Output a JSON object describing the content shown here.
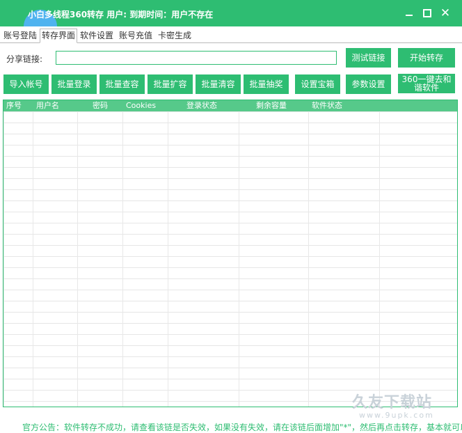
{
  "window": {
    "title": "小白多线程360转存 用户: 到期时间：用户不存在",
    "controls": {
      "minimize": "minimize-icon",
      "maximize": "maximize-icon",
      "close": "✕"
    }
  },
  "tabs": [
    {
      "label": "账号登陆",
      "active": false
    },
    {
      "label": "转存界面",
      "active": true
    },
    {
      "label": "软件设置",
      "active": false
    },
    {
      "label": "账号充值",
      "active": false
    },
    {
      "label": "卡密生成",
      "active": false
    }
  ],
  "share": {
    "label": "分享链接:",
    "value": "",
    "test_button": "测试链接",
    "start_button": "开始转存"
  },
  "toolbar": {
    "buttons": [
      {
        "label": "导入帐号"
      },
      {
        "label": "批量登录"
      },
      {
        "label": "批量查容"
      },
      {
        "label": "批量扩容"
      },
      {
        "label": "批量清容"
      },
      {
        "label": "批量抽奖"
      },
      {
        "label": "设置宝箱"
      },
      {
        "label": "参数设置"
      },
      {
        "label": "360一键去和谐软件"
      }
    ]
  },
  "table": {
    "columns": [
      "序号",
      "用户名",
      "密码",
      "Cookies",
      "登录状态",
      "剩余容量",
      "软件状态"
    ],
    "rows": []
  },
  "footer": {
    "text": "官方公告：软件转存不成功，请查看该链是否失效，如果没有失效，请在该链后面增加\"*\"，然后再点击转存，基本就可以了"
  },
  "watermark": {
    "main": "久友下载站",
    "sub": "www.9upk.com"
  },
  "colors": {
    "accent": "#2ebd72",
    "header": "#56c98a",
    "bubble": "#4fb3ef"
  }
}
